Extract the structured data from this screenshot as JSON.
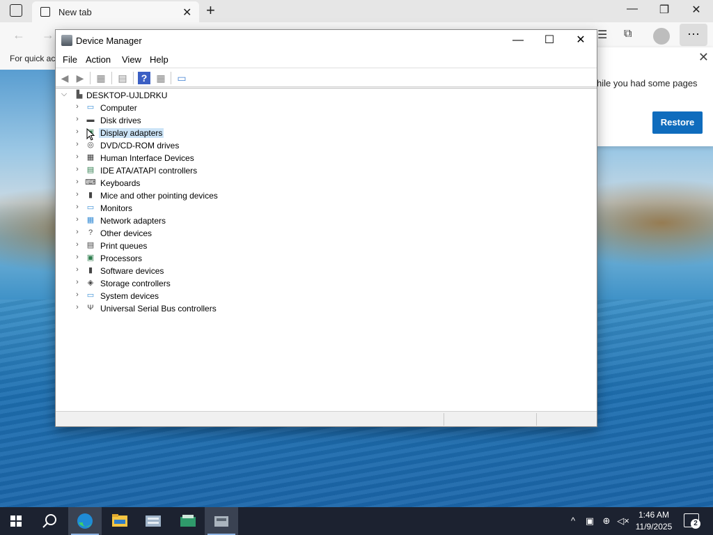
{
  "browser": {
    "tab_title": "New tab",
    "favorites_text": "For quick ac",
    "restore_message": "hile you had some pages",
    "restore_button": "Restore",
    "more_label": "···"
  },
  "device_manager": {
    "title": "Device Manager",
    "menu": [
      "File",
      "Action",
      "View",
      "Help"
    ],
    "root": "DESKTOP-UJLDRKU",
    "selected": "Display adapters",
    "categories": [
      {
        "label": "Computer",
        "icon": "computer-icon"
      },
      {
        "label": "Disk drives",
        "icon": "disk-drive-icon"
      },
      {
        "label": "Display adapters",
        "icon": "display-adapter-icon"
      },
      {
        "label": "DVD/CD-ROM drives",
        "icon": "dvd-drive-icon"
      },
      {
        "label": "Human Interface Devices",
        "icon": "hid-icon"
      },
      {
        "label": "IDE ATA/ATAPI controllers",
        "icon": "ide-controller-icon"
      },
      {
        "label": "Keyboards",
        "icon": "keyboard-icon"
      },
      {
        "label": "Mice and other pointing devices",
        "icon": "mouse-icon"
      },
      {
        "label": "Monitors",
        "icon": "monitor-icon"
      },
      {
        "label": "Network adapters",
        "icon": "network-adapter-icon"
      },
      {
        "label": "Other devices",
        "icon": "other-devices-icon"
      },
      {
        "label": "Print queues",
        "icon": "printer-icon"
      },
      {
        "label": "Processors",
        "icon": "processor-icon"
      },
      {
        "label": "Software devices",
        "icon": "software-device-icon"
      },
      {
        "label": "Storage controllers",
        "icon": "storage-controller-icon"
      },
      {
        "label": "System devices",
        "icon": "system-devices-icon"
      },
      {
        "label": "Universal Serial Bus controllers",
        "icon": "usb-icon"
      }
    ]
  },
  "taskbar": {
    "time": "1:46 AM",
    "date": "11/9/2025",
    "notification_count": "2"
  }
}
